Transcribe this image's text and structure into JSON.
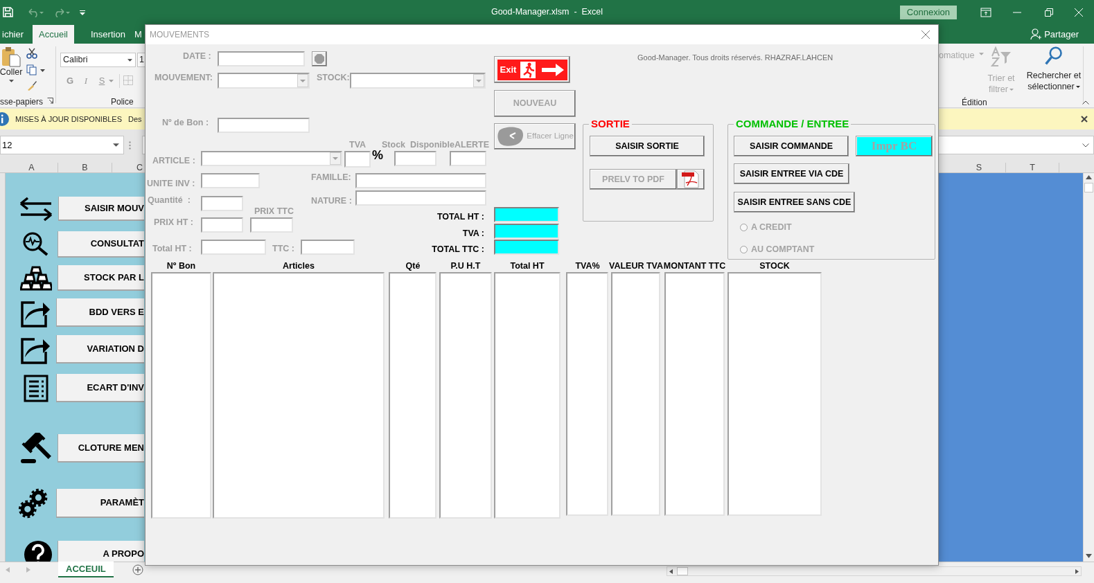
{
  "excel": {
    "title": "Good-Manager.xlsm  -  Excel",
    "sign_in": "Connexion",
    "share": "Partager",
    "ribbon_tabs": [
      {
        "label": "ichier",
        "selected": false
      },
      {
        "label": "Accueil",
        "selected": true
      },
      {
        "label": "Insertion",
        "selected": false
      },
      {
        "label": "M",
        "selected": false
      }
    ],
    "clipboard": {
      "paste": "Coller",
      "group": "sse-papiers"
    },
    "font": {
      "name": "Calibri",
      "size": "1",
      "bold": "G",
      "italic": "I",
      "underline": "S",
      "group": "Police"
    },
    "editing": {
      "autosum": "omatique",
      "sort": "Trier et",
      "sort_2": "filtrer",
      "find": "Rechercher et",
      "find_2": "sélectionner",
      "group": "Édition"
    },
    "notice": {
      "title": "MISES À JOUR DISPONIBLES",
      "text": "Des"
    },
    "name_box": "12",
    "columns": [
      "A",
      "B",
      "C",
      "S",
      "T"
    ],
    "sheet_buttons": [
      "SAISIR MOUV",
      "CONSULTAT",
      "STOCK PAR L",
      "BDD VERS E",
      "VARIATION D",
      "ECART D'INV",
      "CLOTURE MEN",
      "PARAMÈT",
      "A PROPO"
    ],
    "sheet_tabs": [
      {
        "label": "ACCEUIL",
        "selected": true
      }
    ]
  },
  "dialog": {
    "title": "MOUVEMENTS",
    "copyright": "Good-Manager. Tous droits réservés. RHAZRAF.LAHCEN",
    "labels": [
      {
        "text": "DATE :",
        "kind": "muted"
      },
      {
        "text": "MOUVEMENT:",
        "kind": "muted"
      },
      {
        "text": "STOCK:",
        "kind": "muted"
      },
      {
        "text": "Nº de Bon :",
        "kind": "muted"
      },
      {
        "text": "TVA",
        "kind": "muted"
      },
      {
        "text": "Stock  Disponible",
        "kind": "muted"
      },
      {
        "text": "ALERTE",
        "kind": "muted"
      },
      {
        "text": "ARTICLE :",
        "kind": "muted"
      },
      {
        "text": "%",
        "kind": "symbol"
      },
      {
        "text": "UNITE INV :",
        "kind": "muted"
      },
      {
        "text": "FAMILLE:",
        "kind": "muted"
      },
      {
        "text": "Quantité  :",
        "kind": "muted"
      },
      {
        "text": "NATURE :",
        "kind": "muted"
      },
      {
        "text": "PRIX TTC",
        "kind": "muted"
      },
      {
        "text": "PRIX HT :",
        "kind": "muted"
      },
      {
        "text": "Total HT :",
        "kind": "muted"
      },
      {
        "text": "TTC :",
        "kind": "muted"
      },
      {
        "text": "TOTAL HT :",
        "kind": "strong"
      },
      {
        "text": "TVA :",
        "kind": "strong"
      },
      {
        "text": "TOTAL TTC :",
        "kind": "strong"
      }
    ],
    "fields": [
      {
        "kind": "text"
      },
      {
        "kind": "combo"
      },
      {
        "kind": "combo"
      },
      {
        "kind": "text"
      },
      {
        "kind": "combo"
      },
      {
        "kind": "text"
      },
      {
        "kind": "text"
      },
      {
        "kind": "text"
      },
      {
        "kind": "text"
      },
      {
        "kind": "text"
      },
      {
        "kind": "text"
      },
      {
        "kind": "text"
      },
      {
        "kind": "text"
      },
      {
        "kind": "text"
      },
      {
        "kind": "text"
      },
      {
        "kind": "text"
      },
      {
        "kind": "total"
      },
      {
        "kind": "total"
      },
      {
        "kind": "total"
      }
    ],
    "tool_buttons": [
      {
        "kind": "calendar"
      },
      {
        "kind": "exit",
        "label": "Exit",
        "disabled": false
      },
      {
        "kind": "plain",
        "label": "NOUVEAU",
        "disabled": true
      },
      {
        "kind": "clear",
        "label": "Effacer Ligne",
        "disabled": true
      }
    ],
    "sortie": {
      "legend": "SORTIE",
      "color": "#ff0000",
      "buttons": [
        {
          "kind": "plain",
          "label": "SAISIR SORTIE",
          "disabled": false
        },
        {
          "kind": "plain",
          "label": "PRELV TO PDF",
          "disabled": true
        },
        {
          "kind": "pdf"
        }
      ]
    },
    "commande": {
      "legend": "COMMANDE / ENTREE",
      "color": "#00c000",
      "buttons": [
        {
          "kind": "plain",
          "label": "SAISIR COMMANDE",
          "disabled": false
        },
        {
          "kind": "print",
          "label": "Impr BC",
          "disabled": true
        },
        {
          "kind": "plain",
          "label": "SAISIR ENTREE VIA CDE",
          "disabled": false
        },
        {
          "kind": "plain",
          "label": "SAISIR ENTREE SANS CDE",
          "disabled": false
        }
      ],
      "radios": [
        {
          "label": "A CREDIT",
          "selected": false,
          "disabled": true
        },
        {
          "label": "AU COMPTANT",
          "selected": false,
          "disabled": true
        }
      ]
    },
    "table": {
      "columns": [
        "Nº Bon",
        "Articles",
        "Qté",
        "P.U H.T",
        "Total HT",
        "TVA%",
        "VALEUR TVA",
        "MONTANT TTC",
        "STOCK"
      ]
    }
  }
}
